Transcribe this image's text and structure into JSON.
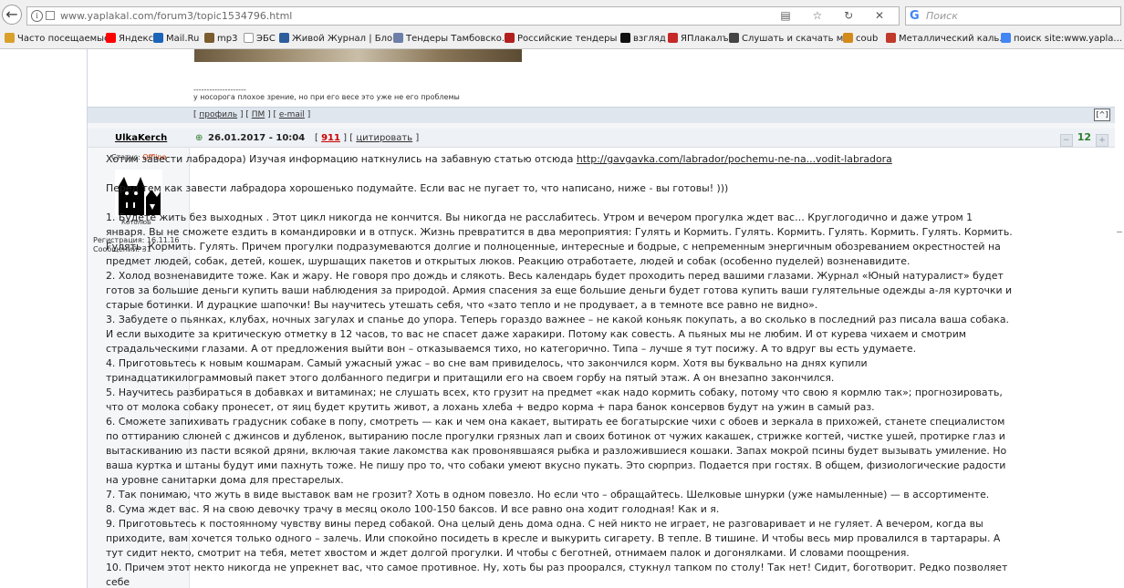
{
  "browser": {
    "url_path": "www.yaplakal.com/forum3/topic1534796.html",
    "search_placeholder": "Поиск",
    "search_engine_glyph": "G",
    "url_icons": "▤ ☆ ↻ ✕",
    "back_icon": "←"
  },
  "bookmarks": [
    {
      "label": "Часто посещаемые",
      "icon": "book-icon",
      "color": "#d9a12a"
    },
    {
      "label": "Яндекс",
      "icon": "yandex-icon",
      "color": "#ff0000"
    },
    {
      "label": "Mail.Ru",
      "icon": "mailru-icon",
      "color": "#1b64b8"
    },
    {
      "label": "mp3",
      "icon": "music-icon",
      "color": "#7a5c2e"
    },
    {
      "label": "ЭБС",
      "icon": "page-icon",
      "color": "#ffffff"
    },
    {
      "label": "Живой Журнал | Бло...",
      "icon": "livejournal-icon",
      "color": "#2d5d9c"
    },
    {
      "label": "Тендеры Тамбовско...",
      "icon": "tender-icon",
      "color": "#6d7fa8"
    },
    {
      "label": "Российские тендеры ...",
      "icon": "rt-icon",
      "color": "#b21f1f"
    },
    {
      "label": "взгляд",
      "icon": "vzglyad-icon",
      "color": "#111111"
    },
    {
      "label": "ЯПлакалъ",
      "icon": "yaplakal-icon",
      "color": "#c62828"
    },
    {
      "label": "Слушать и скачать м...",
      "icon": "headphones-icon",
      "color": "#444444"
    },
    {
      "label": "coub",
      "icon": "coub-icon",
      "color": "#d48a1a"
    },
    {
      "label": "Металлический каль...",
      "icon": "metal-icon",
      "color": "#c0392b"
    },
    {
      "label": "поиск site:www.yapla...",
      "icon": "google-icon",
      "color": "#4285f4"
    }
  ],
  "prev_post": {
    "signature_line": "--------------------",
    "signature_text": "у носорога плохое зрение, но при его весе это уже не его проблемы",
    "links_prefix": "[ ",
    "profile": "профиль",
    "sep1": " ] [ ",
    "pm": "ПМ",
    "sep2": " ] [ ",
    "email": "e-mail",
    "links_suffix": " ]",
    "top_button": "[^]"
  },
  "post": {
    "author": "UlkaKerch",
    "anchor_icon": "⊕",
    "date": "26.01.2017 - 10:04",
    "num_prefix": "[ ",
    "num": "911",
    "num_sep": " ] [ ",
    "quote": "цитировать",
    "num_suffix": " ]",
    "rating": "12",
    "rating_minus": "−",
    "rating_plus": "+",
    "status_label": "Статус: ",
    "status_value": "Offline",
    "avatar_label": "КотолюБ",
    "registration": "Регистрация: 16.11.16",
    "messages": "Сообщений: 31",
    "intro": "Хотим завести лабрадора) Изучая информацию наткнулись на забавную статью отсюда ",
    "intro_link": "http://gavgavka.com/labrador/pochemu-ne-na...vodit-labradora",
    "warning": "Перед тем как завести лабрадора хорошенько подумайте. Если вас не пугает то, что написано, ниже - вы готовы! )))",
    "items": [
      "1. Будете жить без выходных . Этот цикл никогда не кончится. Вы никогда не расслабитесь. Утром и вечером прогулка ждет вас… Круглогодично и даже утром 1 января. Вы не сможете ездить в командировки и в отпуск. Жизнь превратится в два мероприятия: Гулять и Кормить. Гулять. Кормить. Гулять. Кормить. Гулять. Кормить. Гулять. Кормить. Гулять. Причем прогулки подразумеваются долгие и полноценные, интересные и бодрые, с непременным энергичным обозреванием окрестностей на предмет людей, собак, детей, кошек, шуршащих пакетов и открытых люков. Реакцию отработаете, людей и собак (особенно пуделей) возненавидите.",
      "2. Холод возненавидите тоже. Как и жару. Не говоря про дождь и слякоть. Весь календарь будет проходить перед вашими глазами. Журнал «Юный натуралист» будет готов за большие деньги купить ваши наблюдения за природой. Армия спасения за еще большие деньги будет готова купить ваши гулятельные одежды а-ля курточки и старые ботинки. И дурацкие шапочки! Вы научитесь утешать себя, что «зато тепло и не продувает, а в темноте все равно не видно».",
      "3. Забудете о пьянках, клубах, ночных загулах и спанье до упора. Теперь гораздо важнее – не какой коньяк покупать, а во сколько в последний раз писала ваша собака. И если выходите за критическую отметку в 12 часов, то вас не спасет даже харакири. Потому как совесть. А пьяных мы не любим. И от курева чихаем и смотрим страдальческими глазами. А от предложения выйти вон – отказываемся тихо, но категорично. Типа – лучше я тут посижу. А то вдруг вы есть удумаете.",
      "4. Приготовьтесь к новым кошмарам. Самый ужасный ужас – во сне вам привиделось, что закончился корм. Хотя вы буквально на днях купили тринадцатикилограммовый пакет этого долбанного педигри и притащили его на своем горбу на пятый этаж. А он внезапно закончился.",
      "5. Научитесь разбираться в добавках и витаминах; не слушать всех, кто грузит на предмет «как надо кормить собаку, потому что свою я кормлю так»; прогнозировать, что от молока собаку пронесет, от яиц будет крутить живот, а лохань хлеба + ведро корма + пара банок консервов будут на ужин в самый раз.",
      "6. Сможете запихивать градусник собаке в попу, смотреть — как и чем она какает, вытирать ее богатырские чихи с обоев и зеркала в прихожей, станете специалистом по оттиранию слюней с джинсов и дубленок, вытиранию после прогулки грязных лап и своих ботинок от чужих какашек, стрижке когтей, чистке ушей, протирке глаз и вытаскиванию из пасти всякой дряни, включая такие лакомства как провонявшаяся рыбка и разложившиеся кошаки. Запах мокрой псины будет вызывать умиление. Но ваша куртка и штаны будут ими пахнуть тоже. Не пишу про то, что собаки умеют вкусно пукать. Это сюрприз. Подается при гостях. В общем, физиологические радости на уровне санитарки дома для престарелых.",
      "7. Так понимаю, что жуть в виде выставок вам не грозит? Хоть в одном повезло. Но если что – обращайтесь. Шелковые шнурки (уже намыленные) — в ассортименте.",
      "8. Сума ждет вас. Я на свою девочку трачу в месяц около 100-150 баксов. И все равно она ходит голодная! Как и я.",
      "9. Приготовьтесь к постоянному чувству вины перед собакой. Она целый день дома одна. С ней никто не играет, не разговаривает и не гуляет. А вечером, когда вы приходите, вам хочется только одного – залечь. Или спокойно посидеть в кресле и выкурить сигарету. В тепле. В тишине. И чтобы весь мир провалился в тартарары. А тут сидит некто, смотрит на тебя, метет хвостом и ждет долгой прогулки. И чтобы с беготней, отнимаем палок и догонялками. И словами поощрения.",
      "10. Причем этот некто никогда не упрекнет вас, что самое противное. Ну, хоть бы раз проорался, стукнул тапком по столу! Так нет! Сидит, боготворит. Редко позволяет себе"
    ]
  }
}
